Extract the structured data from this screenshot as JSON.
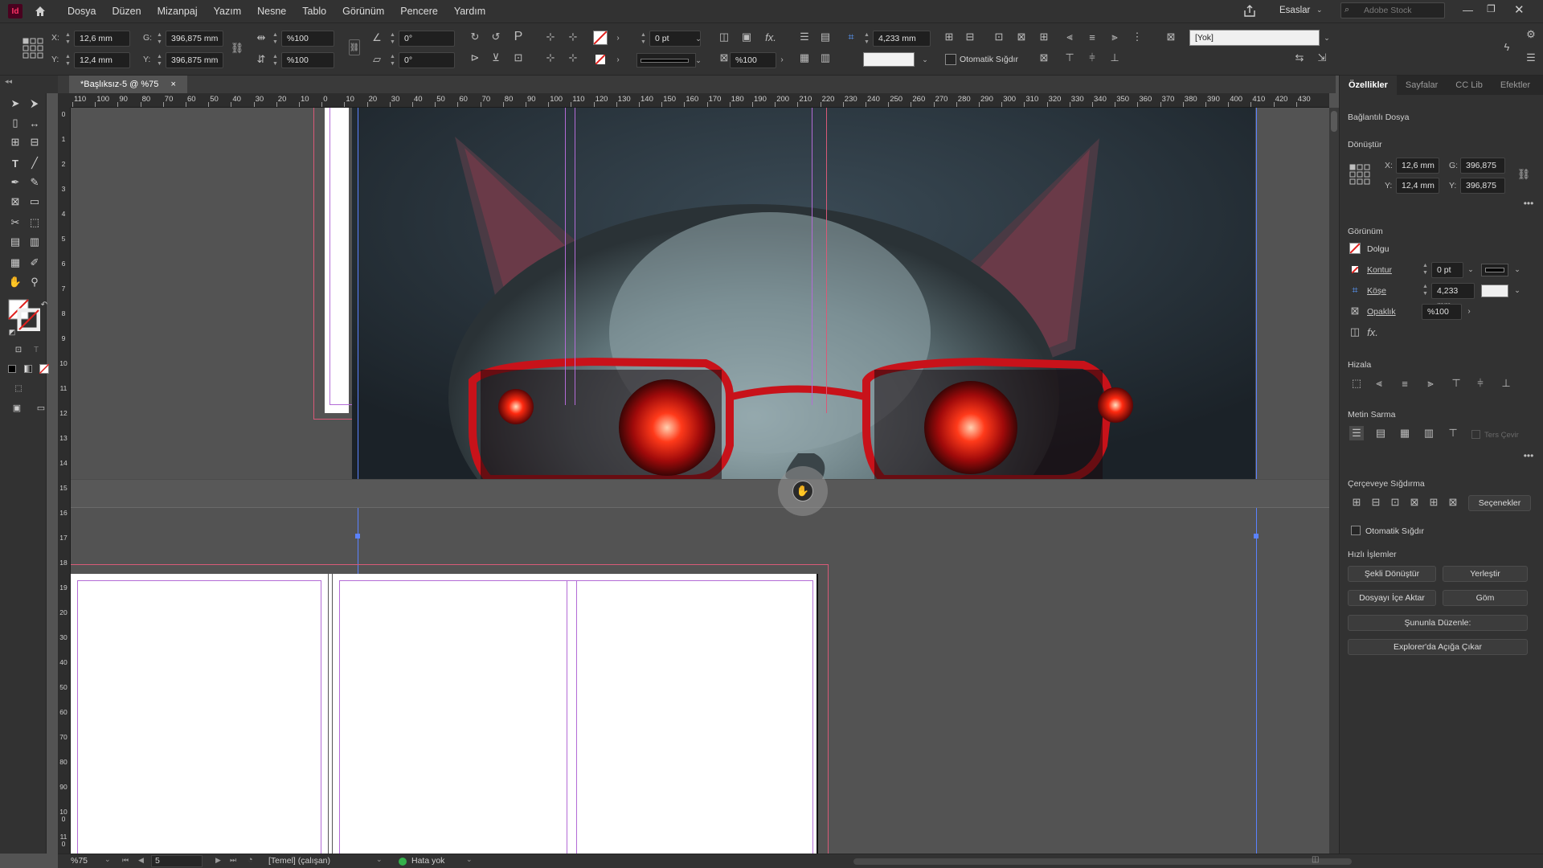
{
  "menubar": {
    "app_logo": "Id",
    "items": [
      "Dosya",
      "Düzen",
      "Mizanpaj",
      "Yazım",
      "Nesne",
      "Tablo",
      "Görünüm",
      "Pencere",
      "Yardım"
    ],
    "workspace": "Esaslar",
    "search_placeholder": "Adobe Stock"
  },
  "control": {
    "x_label": "X:",
    "x_value": "12,6 mm",
    "y_label": "Y:",
    "y_value": "12,4 mm",
    "w_label": "G:",
    "w_value": "396,875 mm",
    "h_label": "Y:",
    "h_value": "396,875 mm",
    "scale_x": "%100",
    "scale_y": "%100",
    "rotate": "0°",
    "shear": "0°",
    "stroke_weight": "0 pt",
    "opacity": "%100",
    "corner_size": "4,233 mm",
    "auto_fit": "Otomatik Sığdır",
    "style_dropdown": "[Yok]"
  },
  "document": {
    "tab_label": "*Başlıksız-5 @ %75",
    "close": "×"
  },
  "ruler": {
    "h_ticks": [
      "110",
      "100",
      "90",
      "80",
      "70",
      "60",
      "50",
      "40",
      "30",
      "20",
      "10",
      "0",
      "10",
      "20",
      "30",
      "40",
      "50",
      "60",
      "70",
      "80",
      "90",
      "100",
      "110",
      "120",
      "130",
      "140",
      "150",
      "160",
      "170",
      "180",
      "190",
      "200",
      "210",
      "220",
      "230",
      "240",
      "250",
      "260",
      "270",
      "280",
      "290",
      "300",
      "310",
      "320",
      "330",
      "340",
      "350",
      "360",
      "370",
      "380",
      "390",
      "400",
      "410",
      "420",
      "430"
    ],
    "v_ticks": [
      "0",
      "1",
      "2",
      "3",
      "4",
      "5",
      "6",
      "7",
      "8",
      "9",
      "10",
      "11",
      "12",
      "13",
      "14",
      "15",
      "16",
      "17",
      "18",
      "19",
      "20",
      "30",
      "40",
      "50",
      "60",
      "70",
      "80",
      "90",
      "100",
      "110"
    ]
  },
  "panel": {
    "tabs": [
      "Özellikler",
      "Sayfalar",
      "CC Lib",
      "Efektler"
    ],
    "object_type": "Bağlantılı Dosya",
    "transform_title": "Dönüştür",
    "x_label": "X:",
    "x_value": "12,6 mm",
    "y_label": "Y:",
    "y_value": "12,4 mm",
    "w_label": "G:",
    "w_value": "396,875 mm",
    "h_label": "Y:",
    "h_value": "396,875 mm",
    "appearance_title": "Görünüm",
    "fill_label": "Dolgu",
    "stroke_label": "Kontur",
    "stroke_value": "0 pt",
    "corner_label": "Köşe",
    "corner_value": "4,233 mm",
    "opacity_label": "Opaklık",
    "opacity_value": "%100",
    "align_title": "Hizala",
    "wrap_title": "Metin Sarma",
    "wrap_invert": "Ters Çevir",
    "fit_title": "Çerçeveye Sığdırma",
    "fit_options": "Seçenekler",
    "fit_auto": "Otomatik Sığdır",
    "quick_title": "Hızlı İşlemler",
    "btn_convert": "Şekli Dönüştür",
    "btn_place": "Yerleştir",
    "btn_import": "Dosyayı İçe Aktar",
    "btn_embed": "Göm",
    "btn_edit_with": "Şununla Düzenle:",
    "btn_reveal": "Explorer'da Açığa Çıkar"
  },
  "status": {
    "zoom": "%75",
    "page": "5",
    "profile": "[Temel] (çalışan)",
    "errors": "Hata yok"
  },
  "colors": {
    "accent_red": "#ff2a2a",
    "guide_purple": "#b36bd6",
    "guide_blue": "#5b82ff",
    "bleed_pink": "#d85a78",
    "ok_green": "#33b04a"
  }
}
